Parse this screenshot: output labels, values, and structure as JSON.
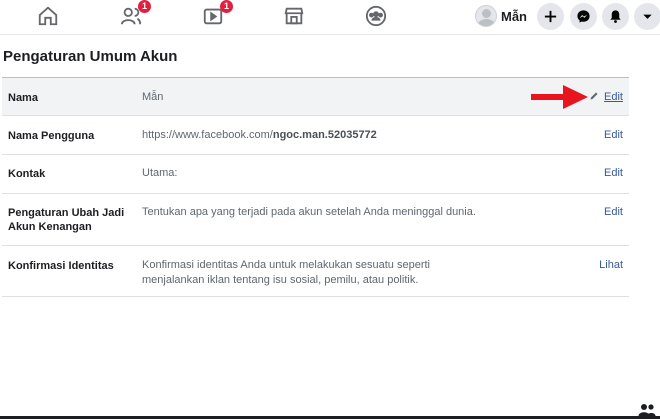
{
  "nav": {
    "icons": [
      "home-icon",
      "friends-icon",
      "watch-icon",
      "marketplace-icon",
      "groups-icon"
    ],
    "friends_badge": "1",
    "watch_badge": "1",
    "profile_name": "Mẫn",
    "actions": [
      "create-icon",
      "messenger-icon",
      "notifications-icon",
      "account-menu-icon"
    ]
  },
  "section": {
    "title": "Pengaturan Umum Akun"
  },
  "rows": [
    {
      "label": "Nama",
      "value": "Mẫn",
      "action": "Edit"
    },
    {
      "label": "Nama Pengguna",
      "value_prefix": "https://www.facebook.com/",
      "value_bold": "ngoc.man.52035772",
      "action": "Edit"
    },
    {
      "label": "Kontak",
      "value": "Utama:",
      "action": "Edit"
    },
    {
      "label_line1": "Pengaturan Ubah Jadi",
      "label_line2": "Akun Kenangan",
      "value": "Tentukan apa yang terjadi pada akun setelah Anda meninggal dunia.",
      "action": "Edit"
    },
    {
      "label": "Konfirmasi Identitas",
      "value_line1": "Konfirmasi identitas Anda untuk melakukan sesuatu seperti",
      "value_line2": "menjalankan iklan tentang isu sosial, pemilu, atau politik.",
      "action": "Lihat"
    }
  ],
  "colors": {
    "link": "#385898",
    "badge": "#e41e3f",
    "annotation_arrow": "#e8141e",
    "highlight_row": "#f2f3f5"
  }
}
